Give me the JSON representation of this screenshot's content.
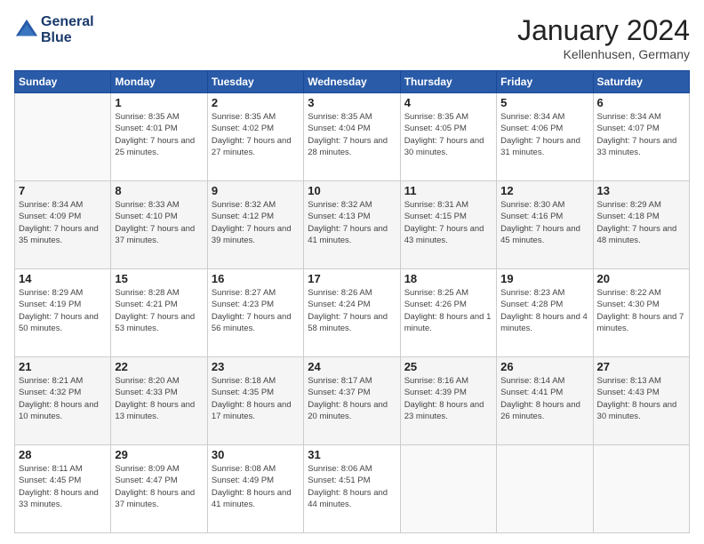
{
  "header": {
    "logo_line1": "General",
    "logo_line2": "Blue",
    "month_title": "January 2024",
    "location": "Kellenhusen, Germany"
  },
  "days_of_week": [
    "Sunday",
    "Monday",
    "Tuesday",
    "Wednesday",
    "Thursday",
    "Friday",
    "Saturday"
  ],
  "weeks": [
    [
      {
        "num": "",
        "sunrise": "",
        "sunset": "",
        "daylight": ""
      },
      {
        "num": "1",
        "sunrise": "Sunrise: 8:35 AM",
        "sunset": "Sunset: 4:01 PM",
        "daylight": "Daylight: 7 hours and 25 minutes."
      },
      {
        "num": "2",
        "sunrise": "Sunrise: 8:35 AM",
        "sunset": "Sunset: 4:02 PM",
        "daylight": "Daylight: 7 hours and 27 minutes."
      },
      {
        "num": "3",
        "sunrise": "Sunrise: 8:35 AM",
        "sunset": "Sunset: 4:04 PM",
        "daylight": "Daylight: 7 hours and 28 minutes."
      },
      {
        "num": "4",
        "sunrise": "Sunrise: 8:35 AM",
        "sunset": "Sunset: 4:05 PM",
        "daylight": "Daylight: 7 hours and 30 minutes."
      },
      {
        "num": "5",
        "sunrise": "Sunrise: 8:34 AM",
        "sunset": "Sunset: 4:06 PM",
        "daylight": "Daylight: 7 hours and 31 minutes."
      },
      {
        "num": "6",
        "sunrise": "Sunrise: 8:34 AM",
        "sunset": "Sunset: 4:07 PM",
        "daylight": "Daylight: 7 hours and 33 minutes."
      }
    ],
    [
      {
        "num": "7",
        "sunrise": "Sunrise: 8:34 AM",
        "sunset": "Sunset: 4:09 PM",
        "daylight": "Daylight: 7 hours and 35 minutes."
      },
      {
        "num": "8",
        "sunrise": "Sunrise: 8:33 AM",
        "sunset": "Sunset: 4:10 PM",
        "daylight": "Daylight: 7 hours and 37 minutes."
      },
      {
        "num": "9",
        "sunrise": "Sunrise: 8:32 AM",
        "sunset": "Sunset: 4:12 PM",
        "daylight": "Daylight: 7 hours and 39 minutes."
      },
      {
        "num": "10",
        "sunrise": "Sunrise: 8:32 AM",
        "sunset": "Sunset: 4:13 PM",
        "daylight": "Daylight: 7 hours and 41 minutes."
      },
      {
        "num": "11",
        "sunrise": "Sunrise: 8:31 AM",
        "sunset": "Sunset: 4:15 PM",
        "daylight": "Daylight: 7 hours and 43 minutes."
      },
      {
        "num": "12",
        "sunrise": "Sunrise: 8:30 AM",
        "sunset": "Sunset: 4:16 PM",
        "daylight": "Daylight: 7 hours and 45 minutes."
      },
      {
        "num": "13",
        "sunrise": "Sunrise: 8:29 AM",
        "sunset": "Sunset: 4:18 PM",
        "daylight": "Daylight: 7 hours and 48 minutes."
      }
    ],
    [
      {
        "num": "14",
        "sunrise": "Sunrise: 8:29 AM",
        "sunset": "Sunset: 4:19 PM",
        "daylight": "Daylight: 7 hours and 50 minutes."
      },
      {
        "num": "15",
        "sunrise": "Sunrise: 8:28 AM",
        "sunset": "Sunset: 4:21 PM",
        "daylight": "Daylight: 7 hours and 53 minutes."
      },
      {
        "num": "16",
        "sunrise": "Sunrise: 8:27 AM",
        "sunset": "Sunset: 4:23 PM",
        "daylight": "Daylight: 7 hours and 56 minutes."
      },
      {
        "num": "17",
        "sunrise": "Sunrise: 8:26 AM",
        "sunset": "Sunset: 4:24 PM",
        "daylight": "Daylight: 7 hours and 58 minutes."
      },
      {
        "num": "18",
        "sunrise": "Sunrise: 8:25 AM",
        "sunset": "Sunset: 4:26 PM",
        "daylight": "Daylight: 8 hours and 1 minute."
      },
      {
        "num": "19",
        "sunrise": "Sunrise: 8:23 AM",
        "sunset": "Sunset: 4:28 PM",
        "daylight": "Daylight: 8 hours and 4 minutes."
      },
      {
        "num": "20",
        "sunrise": "Sunrise: 8:22 AM",
        "sunset": "Sunset: 4:30 PM",
        "daylight": "Daylight: 8 hours and 7 minutes."
      }
    ],
    [
      {
        "num": "21",
        "sunrise": "Sunrise: 8:21 AM",
        "sunset": "Sunset: 4:32 PM",
        "daylight": "Daylight: 8 hours and 10 minutes."
      },
      {
        "num": "22",
        "sunrise": "Sunrise: 8:20 AM",
        "sunset": "Sunset: 4:33 PM",
        "daylight": "Daylight: 8 hours and 13 minutes."
      },
      {
        "num": "23",
        "sunrise": "Sunrise: 8:18 AM",
        "sunset": "Sunset: 4:35 PM",
        "daylight": "Daylight: 8 hours and 17 minutes."
      },
      {
        "num": "24",
        "sunrise": "Sunrise: 8:17 AM",
        "sunset": "Sunset: 4:37 PM",
        "daylight": "Daylight: 8 hours and 20 minutes."
      },
      {
        "num": "25",
        "sunrise": "Sunrise: 8:16 AM",
        "sunset": "Sunset: 4:39 PM",
        "daylight": "Daylight: 8 hours and 23 minutes."
      },
      {
        "num": "26",
        "sunrise": "Sunrise: 8:14 AM",
        "sunset": "Sunset: 4:41 PM",
        "daylight": "Daylight: 8 hours and 26 minutes."
      },
      {
        "num": "27",
        "sunrise": "Sunrise: 8:13 AM",
        "sunset": "Sunset: 4:43 PM",
        "daylight": "Daylight: 8 hours and 30 minutes."
      }
    ],
    [
      {
        "num": "28",
        "sunrise": "Sunrise: 8:11 AM",
        "sunset": "Sunset: 4:45 PM",
        "daylight": "Daylight: 8 hours and 33 minutes."
      },
      {
        "num": "29",
        "sunrise": "Sunrise: 8:09 AM",
        "sunset": "Sunset: 4:47 PM",
        "daylight": "Daylight: 8 hours and 37 minutes."
      },
      {
        "num": "30",
        "sunrise": "Sunrise: 8:08 AM",
        "sunset": "Sunset: 4:49 PM",
        "daylight": "Daylight: 8 hours and 41 minutes."
      },
      {
        "num": "31",
        "sunrise": "Sunrise: 8:06 AM",
        "sunset": "Sunset: 4:51 PM",
        "daylight": "Daylight: 8 hours and 44 minutes."
      },
      {
        "num": "",
        "sunrise": "",
        "sunset": "",
        "daylight": ""
      },
      {
        "num": "",
        "sunrise": "",
        "sunset": "",
        "daylight": ""
      },
      {
        "num": "",
        "sunrise": "",
        "sunset": "",
        "daylight": ""
      }
    ]
  ]
}
